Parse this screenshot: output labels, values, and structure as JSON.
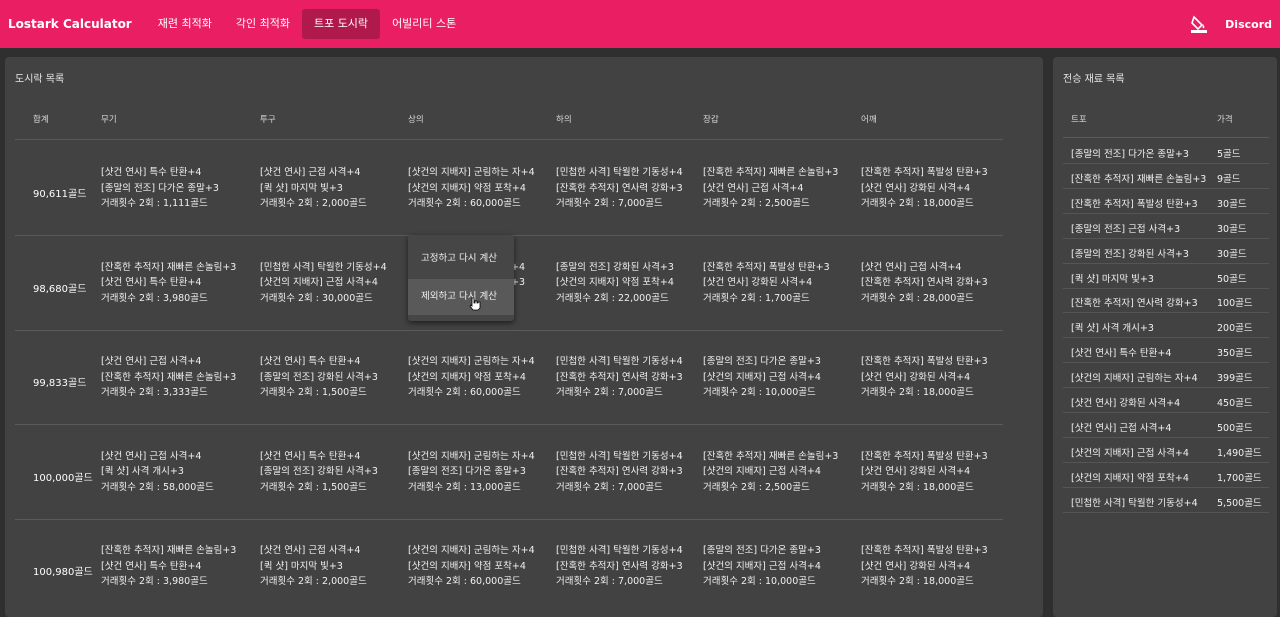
{
  "app": {
    "brand": "Lostark Calculator",
    "tabs": [
      "재련 최적화",
      "각인 최적화",
      "트포 도시락",
      "어빌리티 스톤"
    ],
    "active_tab": 2,
    "discord": "Discord",
    "colors": {
      "accent": "#e91e63",
      "active_tab": "#b0194b",
      "panel": "#424242",
      "background": "#2f2f2f"
    },
    "icons": {
      "theme": "paint-bucket-icon"
    }
  },
  "main": {
    "title": "도시락 목록",
    "headers": [
      "합계",
      "무기",
      "투구",
      "상의",
      "하의",
      "장갑",
      "어깨"
    ],
    "rows": [
      {
        "total": "90,611골드",
        "cells": [
          [
            "[샷건 연사] 특수 탄환+4",
            "[종말의 전조] 다가온 종말+3",
            "거래횟수 2회 : 1,111골드"
          ],
          [
            "[샷건 연사] 근접 사격+4",
            "[퀵 샷] 마지막 빛+3",
            "거래횟수 2회 : 2,000골드"
          ],
          [
            "[샷건의 지배자] 군림하는 자+4",
            "[샷건의 지배자] 약점 포착+4",
            "거래횟수 2회 : 60,000골드"
          ],
          [
            "[민첩한 사격] 탁월한 기동성+4",
            "[잔혹한 추적자] 연사력 강화+3",
            "거래횟수 2회 : 7,000골드"
          ],
          [
            "[잔혹한 추적자] 재빠른 손놀림+3",
            "[샷건 연사] 근접 사격+4",
            "거래횟수 2회 : 2,500골드"
          ],
          [
            "[잔혹한 추적자] 폭발성 탄환+3",
            "[샷건 연사] 강화된 사격+4",
            "거래횟수 2회 : 18,000골드"
          ]
        ]
      },
      {
        "total": "98,680골드",
        "cells": [
          [
            "[잔혹한 추적자] 재빠른 손놀림+3",
            "[샷건 연사] 특수 탄환+4",
            "거래횟수 2회 : 3,980골드"
          ],
          [
            "[민첩한 사격] 탁월한 기동성+4",
            "[샷건의 지배자] 근접 사격+4",
            "거래횟수 2회 : 30,000골드"
          ],
          [
            "+4",
            "+3",
            ""
          ],
          [
            "[종말의 전조] 강화된 사격+3",
            "[샷건의 지배자] 약점 포착+4",
            "거래횟수 2회 : 22,000골드"
          ],
          [
            "[잔혹한 추적자] 폭발성 탄환+3",
            "[샷건 연사] 강화된 사격+4",
            "거래횟수 2회 : 1,700골드"
          ],
          [
            "[샷건 연사] 근접 사격+4",
            "[잔혹한 추적자] 연사력 강화+3",
            "거래횟수 2회 : 28,000골드"
          ]
        ]
      },
      {
        "total": "99,833골드",
        "cells": [
          [
            "[샷건 연사] 근접 사격+4",
            "[잔혹한 추적자] 재빠른 손놀림+3",
            "거래횟수 2회 : 3,333골드"
          ],
          [
            "[샷건 연사] 특수 탄환+4",
            "[종말의 전조] 강화된 사격+3",
            "거래횟수 2회 : 1,500골드"
          ],
          [
            "[샷건의 지배자] 군림하는 자+4",
            "[샷건의 지배자] 약점 포착+4",
            "거래횟수 2회 : 60,000골드"
          ],
          [
            "[민첩한 사격] 탁월한 기동성+4",
            "[잔혹한 추적자] 연사력 강화+3",
            "거래횟수 2회 : 7,000골드"
          ],
          [
            "[종말의 전조] 다가온 종말+3",
            "[샷건의 지배자] 근접 사격+4",
            "거래횟수 2회 : 10,000골드"
          ],
          [
            "[잔혹한 추적자] 폭발성 탄환+3",
            "[샷건 연사] 강화된 사격+4",
            "거래횟수 2회 : 18,000골드"
          ]
        ]
      },
      {
        "total": "100,000골드",
        "cells": [
          [
            "[샷건 연사] 근접 사격+4",
            "[퀵 샷] 사격 개시+3",
            "거래횟수 2회 : 58,000골드"
          ],
          [
            "[샷건 연사] 특수 탄환+4",
            "[종말의 전조] 강화된 사격+3",
            "거래횟수 2회 : 1,500골드"
          ],
          [
            "[샷건의 지배자] 군림하는 자+4",
            "[종말의 전조] 다가온 종말+3",
            "거래횟수 2회 : 13,000골드"
          ],
          [
            "[민첩한 사격] 탁월한 기동성+4",
            "[잔혹한 추적자] 연사력 강화+3",
            "거래횟수 2회 : 7,000골드"
          ],
          [
            "[잔혹한 추적자] 재빠른 손놀림+3",
            "[샷건의 지배자] 근접 사격+4",
            "거래횟수 2회 : 2,500골드"
          ],
          [
            "[잔혹한 추적자] 폭발성 탄환+3",
            "[샷건 연사] 강화된 사격+4",
            "거래횟수 2회 : 18,000골드"
          ]
        ]
      },
      {
        "total": "100,980골드",
        "cells": [
          [
            "[잔혹한 추적자] 재빠른 손놀림+3",
            "[샷건 연사] 특수 탄환+4",
            "거래횟수 2회 : 3,980골드"
          ],
          [
            "[샷건 연사] 근접 사격+4",
            "[퀵 샷] 마지막 빛+3",
            "거래횟수 2회 : 2,000골드"
          ],
          [
            "[샷건의 지배자] 군림하는 자+4",
            "[샷건의 지배자] 약점 포착+4",
            "거래횟수 2회 : 60,000골드"
          ],
          [
            "[민첩한 사격] 탁월한 기동성+4",
            "[잔혹한 추적자] 연사력 강화+3",
            "거래횟수 2회 : 7,000골드"
          ],
          [
            "[종말의 전조] 다가온 종말+3",
            "[샷건의 지배자] 근접 사격+4",
            "거래횟수 2회 : 10,000골드"
          ],
          [
            "[잔혹한 추적자] 폭발성 탄환+3",
            "[샷건 연사] 강화된 사격+4",
            "거래횟수 2회 : 18,000골드"
          ]
        ]
      }
    ],
    "context_menu": [
      "고정하고 다시 계산",
      "제외하고 다시 계산"
    ],
    "context_menu_hover": 1
  },
  "side": {
    "title": "전승 재료 목록",
    "headers": [
      "트포",
      "가격"
    ],
    "items": [
      {
        "name": "[종말의 전조] 다가온 종말+3",
        "price": "5골드"
      },
      {
        "name": "[잔혹한 추적자] 재빠른 손놀림+3",
        "price": "9골드"
      },
      {
        "name": "[잔혹한 추적자] 폭발성 탄환+3",
        "price": "30골드"
      },
      {
        "name": "[종말의 전조] 근접 사격+3",
        "price": "30골드"
      },
      {
        "name": "[종말의 전조] 강화된 사격+3",
        "price": "30골드"
      },
      {
        "name": "[퀵 샷] 마지막 빛+3",
        "price": "50골드"
      },
      {
        "name": "[잔혹한 추적자] 연사력 강화+3",
        "price": "100골드"
      },
      {
        "name": "[퀵 샷] 사격 개시+3",
        "price": "200골드"
      },
      {
        "name": "[샷건 연사] 특수 탄환+4",
        "price": "350골드"
      },
      {
        "name": "[샷건의 지배자] 군림하는 자+4",
        "price": "399골드"
      },
      {
        "name": "[샷건 연사] 강화된 사격+4",
        "price": "450골드"
      },
      {
        "name": "[샷건 연사] 근접 사격+4",
        "price": "500골드"
      },
      {
        "name": "[샷건의 지배자] 근접 사격+4",
        "price": "1,490골드"
      },
      {
        "name": "[샷건의 지배자] 약점 포착+4",
        "price": "1,700골드"
      },
      {
        "name": "[민첩한 사격] 탁월한 기동성+4",
        "price": "5,500골드"
      }
    ]
  }
}
